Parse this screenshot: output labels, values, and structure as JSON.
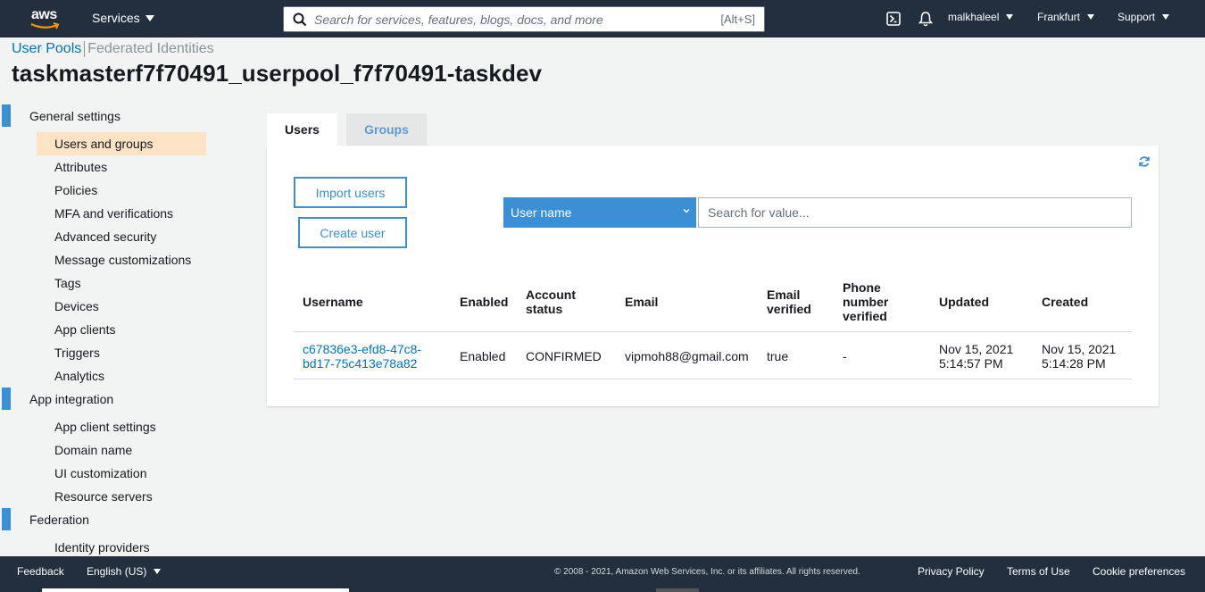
{
  "topnav": {
    "logo_text": "aws",
    "services_label": "Services",
    "search_placeholder": "Search for services, features, blogs, docs, and more",
    "search_shortcut": "[Alt+S]",
    "user": "malkhaleel",
    "region": "Frankfurt",
    "support": "Support"
  },
  "breadcrumb": {
    "user_pools": "User Pools",
    "federated": "Federated Identities"
  },
  "pool_title": "taskmasterf7f70491_userpool_f7f70491-taskdev",
  "sidebar": {
    "general": {
      "title": "General settings",
      "items": [
        "Users and groups",
        "Attributes",
        "Policies",
        "MFA and verifications",
        "Advanced security",
        "Message customizations",
        "Tags",
        "Devices",
        "App clients",
        "Triggers",
        "Analytics"
      ]
    },
    "app_integration": {
      "title": "App integration",
      "items": [
        "App client settings",
        "Domain name",
        "UI customization",
        "Resource servers"
      ]
    },
    "federation": {
      "title": "Federation",
      "items": [
        "Identity providers"
      ]
    }
  },
  "tabs": {
    "users": "Users",
    "groups": "Groups"
  },
  "actions": {
    "import": "Import users",
    "create": "Create user"
  },
  "filter": {
    "selected": "User name",
    "placeholder": "Search for value..."
  },
  "table": {
    "headers": {
      "username": "Username",
      "enabled": "Enabled",
      "account_status_1": "Account",
      "account_status_2": "status",
      "email": "Email",
      "email_verified_1": "Email",
      "email_verified_2": "verified",
      "phone_verified_1": "Phone",
      "phone_verified_2": "number",
      "phone_verified_3": "verified",
      "updated": "Updated",
      "created": "Created"
    },
    "rows": [
      {
        "username_1": "c67836e3-efd8-47c8-",
        "username_2": "bd17-75c413e78a82",
        "enabled": "Enabled",
        "status": "CONFIRMED",
        "email": "vipmoh88@gmail.com",
        "email_verified": "true",
        "phone_verified": "-",
        "updated_1": "Nov 15, 2021",
        "updated_2": "5:14:57 PM",
        "created_1": "Nov 15, 2021",
        "created_2": "5:14:28 PM"
      }
    ]
  },
  "footer": {
    "feedback": "Feedback",
    "language": "English (US)",
    "copyright": "© 2008 - 2021, Amazon Web Services, Inc. or its affiliates. All rights reserved.",
    "privacy": "Privacy Policy",
    "terms": "Terms of Use",
    "cookies": "Cookie preferences"
  },
  "colors": {
    "nav": "#232f3e",
    "accent": "#3b8fd5",
    "link": "#0073bb",
    "selected": "#fbe3c3",
    "smile": "#ff9900"
  }
}
